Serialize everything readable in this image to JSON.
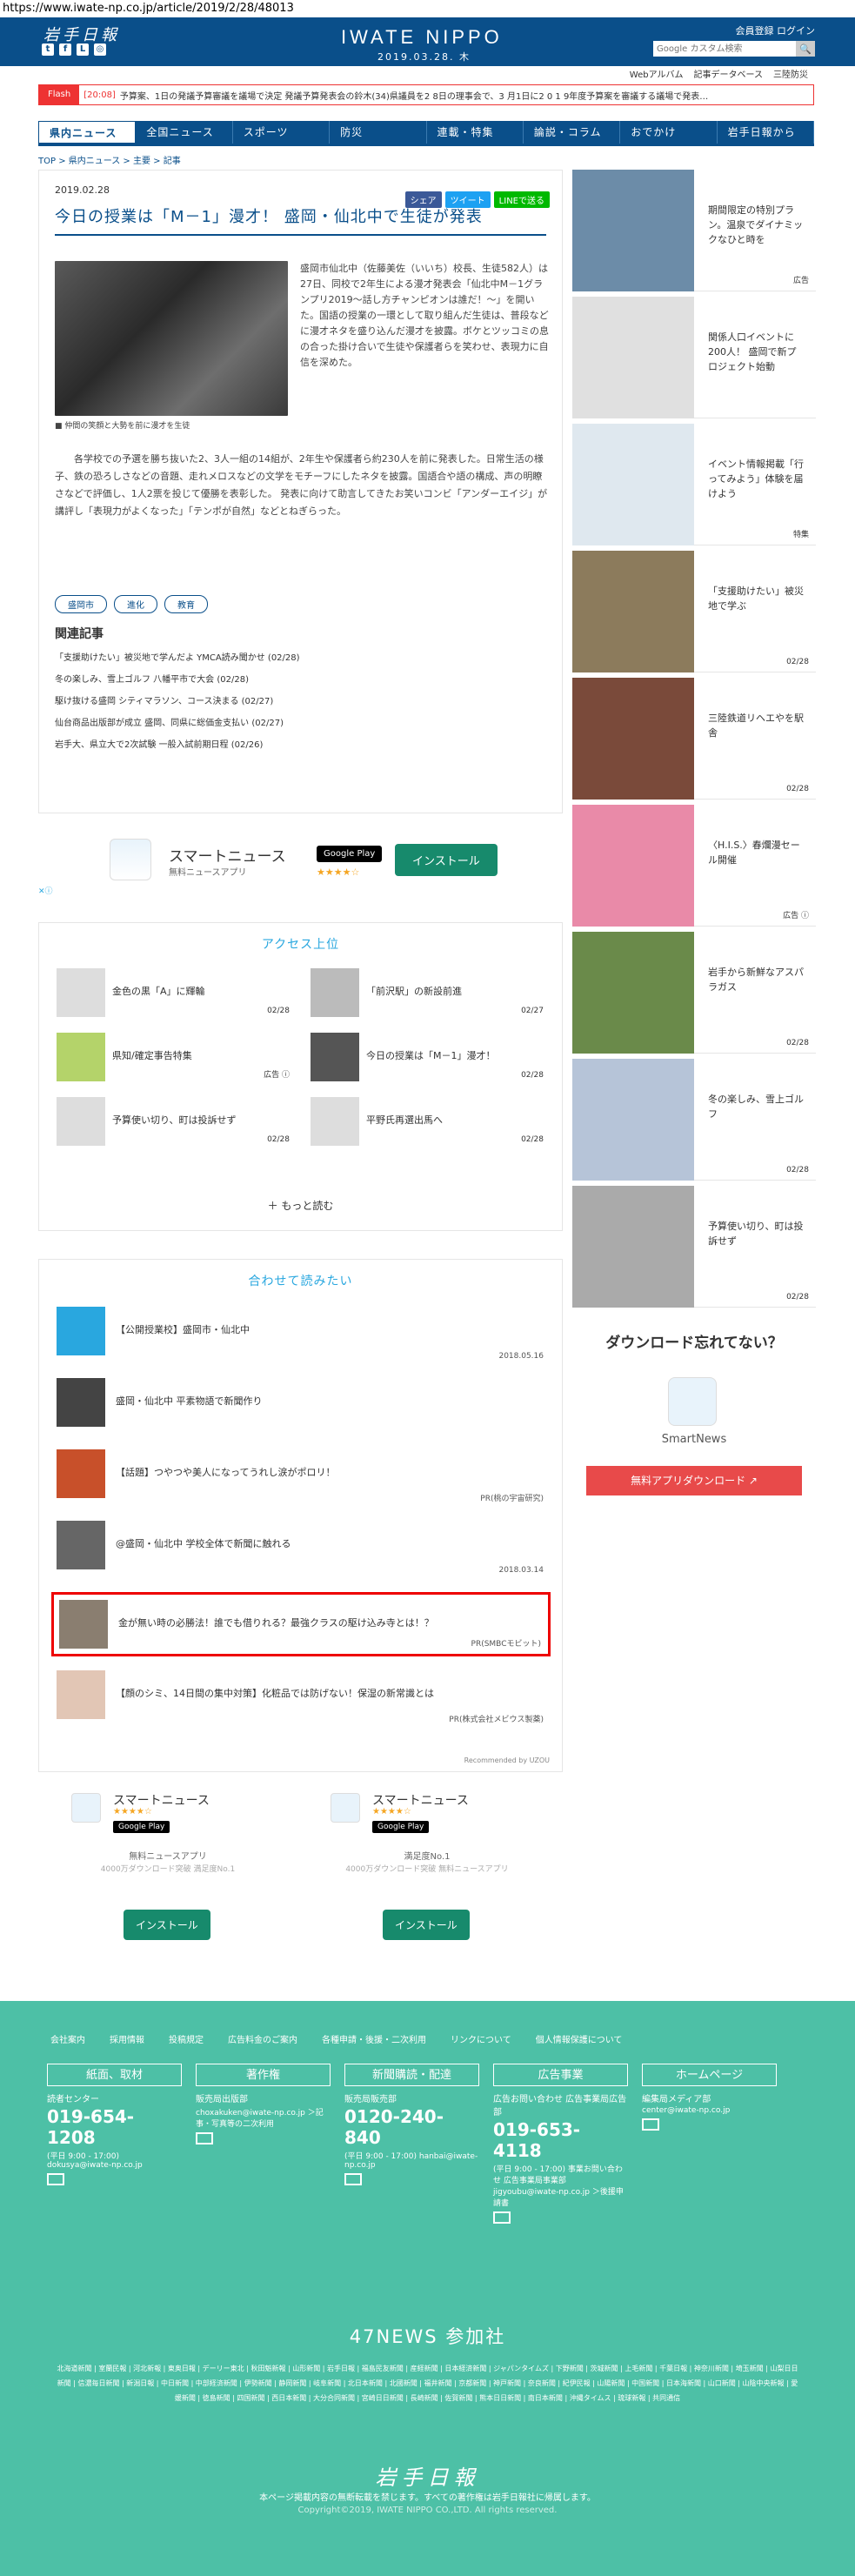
{
  "url": "https://www.iwate-np.co.jp/article/2019/2/28/48013",
  "header": {
    "logo": "岩手日報",
    "brand": "IWATE NIPPO",
    "date": "2019.03.28. 木",
    "login": "会員登録  ログイン",
    "search_placeholder": "Google カスタム検索",
    "search_btn": "🔍"
  },
  "subnav": [
    "Webアルバム",
    "記事データベース",
    "三陸防災"
  ],
  "flash": {
    "tag": "Flash",
    "time": "[20:08]",
    "text": "予算案、1日の発議予算審議を議場で決定  発議予算発表会の鈴木(34)県議員を2 8日の理事会で、3 月1日に2 0 1 9年度予算案を審議する議場で発表…"
  },
  "nav": [
    "県内ニュース",
    "全国ニュース",
    "スポーツ",
    "防災",
    "連載・特集",
    "論説・コラム",
    "おでかけ",
    "岩手日報から"
  ],
  "breadcrumb": "TOP > 県内ニュース > 主要 > 記事",
  "article": {
    "date": "2019.02.28",
    "share": [
      "シェア",
      "ツイート",
      "LINEで送る"
    ],
    "title": "今日の授業は「M－1」漫才！ 盛岡・仙北中で生徒が発表",
    "caption": "■ 仲間の笑顔と大勢を前に漫才を生徒",
    "body1": "盛岡市仙北中（佐藤美佐（いいち）校長、生徒582人）は27日、同校で2年生による漫才発表会「仙北中M－1グランプリ2019～話し方チャンピオンは誰だ！～」を開いた。国語の授業の一環として取り組んだ生徒は、普段などに漫才ネタを盛り込んだ漫才を披露。ボケとツッコミの息の合った掛け合いで生徒や保護者らを笑わせ、表現力に自信を深めた。",
    "body2": "各学校での予選を勝ち抜いた2、3人一組の14組が、2年生や保護者ら約230人を前に発表した。日常生活の様子、鉄の恐ろしさなどの音題、走れメロスなどの文学をモチーフにしたネタを披露。国語合や語の構成、声の明瞭さなどで評価し、1人2票を投じて優勝を表彰した。 発表に向けて助言してきたお笑いコンビ「アンダーエイジ」が講評し「表現力がよくなった」「テンポが自然」などとねぎらった。",
    "tags": [
      "盛岡市",
      "進化",
      "教育"
    ],
    "related_title": "関連記事",
    "related": [
      "「支援助けたい」被災地で学んだよ YMCA読み聞かせ (02/28)",
      "冬の楽しみ、雪上ゴルフ 八幡平市で大会 (02/28)",
      "駆け抜ける盛岡 シティマラソン、コース決まる (02/27)",
      "仙台商品出版部が成立 盛岡、同県に総価金支払い (02/27)",
      "岩手大、県立大で2次試験 一般入試前期日程 (02/26)"
    ]
  },
  "adstrip": {
    "title": "スマートニュース",
    "sub": "無料ニュースアプリ",
    "gplay": "Google Play",
    "stars": "★★★★☆",
    "install": "インストール",
    "choice": "✕ⓘ"
  },
  "ranking": {
    "title": "アクセス上位",
    "items": [
      {
        "t": "金色の黒「A」に輝輪",
        "d": "02/28"
      },
      {
        "t": "「前沢駅」の新設前進",
        "d": "02/27"
      },
      {
        "t": "県知/確定事告特集",
        "d": "広告 ⓘ"
      },
      {
        "t": "今日の授業は「M－1」漫才！",
        "d": "02/28"
      },
      {
        "t": "予算使い切り、町は投訴せず",
        "d": "02/28"
      },
      {
        "t": "平野氏再選出馬へ",
        "d": "02/28"
      }
    ],
    "more": "＋ もっと読む"
  },
  "read": {
    "title": "合わせて読みたい",
    "items": [
      {
        "t": "【公開授業校】盛岡市・仙北中",
        "d": "2018.05.16"
      },
      {
        "t": "盛岡・仙北中 平素物語で新聞作り",
        "d": ""
      },
      {
        "t": "【話題】つやつや美人になってうれし涙がポロリ！",
        "d": "PR(桃の宇宙研究)"
      },
      {
        "t": "@盛岡・仙北中 学校全体で新聞に触れる",
        "d": "2018.03.14"
      },
      {
        "t": "金が無い時の必勝法！誰でも借りれる？最強クラスの駆け込み寺とは！？",
        "d": "PR(SMBCモビット)"
      },
      {
        "t": "【顔のシミ、14日間の集中対策】化粧品では防げない！保湿の新常識とは",
        "d": "PR(株式会社メビウス製薬)"
      }
    ],
    "rec": "Recommended by UZOU"
  },
  "twoads": [
    {
      "title": "スマートニュース",
      "stars": "★★★★☆",
      "gp": "Google Play",
      "l1": "無料ニュースアプリ",
      "l2": "4000万ダウンロード突破 満足度No.1",
      "btn": "インストール"
    },
    {
      "title": "スマートニュース",
      "stars": "★★★★☆",
      "gp": "Google Play",
      "l1": "満足度No.1",
      "l2": "4000万ダウンロード突破 無料ニュースアプリ",
      "btn": "インストール"
    }
  ],
  "side": [
    {
      "t": "期間限定の特別プラン。温泉でダイナミックなひと時を",
      "d": "広告"
    },
    {
      "t": "関係人口イベントに200人！ 盛岡で新プロジェクト始動",
      "d": ""
    },
    {
      "t": "イベント情報掲載「行ってみよう」体験を届けよう",
      "d": "特集"
    },
    {
      "t": "「支援助けたい」被災地で学ぶ",
      "d": "02/28"
    },
    {
      "t": "三陸鉄道リヘエやを駅舎",
      "d": "02/28"
    },
    {
      "t": "〈H.I.S.〉春爛漫セール開催",
      "d": "広告 ⓘ"
    },
    {
      "t": "岩手から新鮮なアスパラガス",
      "d": "02/28"
    },
    {
      "t": "冬の楽しみ、雪上ゴルフ",
      "d": "02/28"
    },
    {
      "t": "予算使い切り、町は投訴せず",
      "d": "02/28"
    }
  ],
  "sidead": {
    "head": "ダウンロード忘れてない？",
    "name": "SmartNews",
    "btn": "無料アプリダウンロード ↗"
  },
  "footer": {
    "links": [
      "会社案内",
      "採用情報",
      "投稿規定",
      "広告料金のご案内",
      "各種申請・後援・二次利用",
      "リンクについて",
      "個人情報保護について"
    ],
    "cols": [
      {
        "h": "紙面、取材",
        "s": "読者センター",
        "p": "019-654-1208",
        "m": "(平日 9:00 - 17:00)  dokusya@iwate-np.co.jp"
      },
      {
        "h": "著作権",
        "s": "販売局出版部",
        "p": "",
        "m": "choxakuken@iwate-np.co.jp  ＞記事・写真等の二次利用"
      },
      {
        "h": "新聞購読・配達",
        "s": "販売局販売部",
        "p": "0120-240-840",
        "m": "(平日 9:00 - 17:00)  hanbai@iwate-np.co.jp"
      },
      {
        "h": "広告事業",
        "s": "広告お問い合わせ 広告事業局広告部",
        "p": "019-653-4118",
        "m": "(平日 9:00 - 17:00)  事業お問い合わせ 広告事業局事業部  jigyoubu@iwate-np.co.jp  ＞後援申請書"
      },
      {
        "h": "ホームページ",
        "s": "編集局メディア部",
        "p": "",
        "m": "center@iwate-np.co.jp"
      }
    ],
    "n47": "47NEWS 参加社",
    "papers": "北海道新聞 | 室蘭民報 | 河北新報 | 東奥日報 | デーリー東北 | 秋田魁新報 | 山形新聞 | 岩手日報 | 福島民友新聞 | 産経新聞 | 日本経済新聞 | ジャパンタイムズ | 下野新聞 | 茨城新聞 | 上毛新聞 | 千葉日報 | 神奈川新聞 | 埼玉新聞 | 山梨日日新聞 | 信濃毎日新聞 | 新潟日報 | 中日新聞 | 中部経済新聞 | 伊勢新聞 | 静岡新聞 | 岐阜新聞 | 北日本新聞 | 北國新聞 | 福井新聞 | 京都新聞 | 神戸新聞 | 奈良新聞 | 紀伊民報 | 山陽新聞 | 中国新聞 | 日本海新聞 | 山口新聞 | 山陰中央新報 | 愛媛新聞 | 徳島新聞 | 四国新聞 | 西日本新聞 | 大分合同新聞 | 宮崎日日新聞 | 長崎新聞 | 佐賀新聞 | 熊本日日新聞 | 南日本新聞 | 沖縄タイムス | 琉球新報 | 共同通信",
    "logo": "岩手日報",
    "note": "本ページ掲載内容の無断転載を禁じます。すべての著作権は岩手日報社に帰属します。",
    "copy": "Copyright©2019, IWATE NIPPO CO.,LTD. All rights reserved."
  }
}
